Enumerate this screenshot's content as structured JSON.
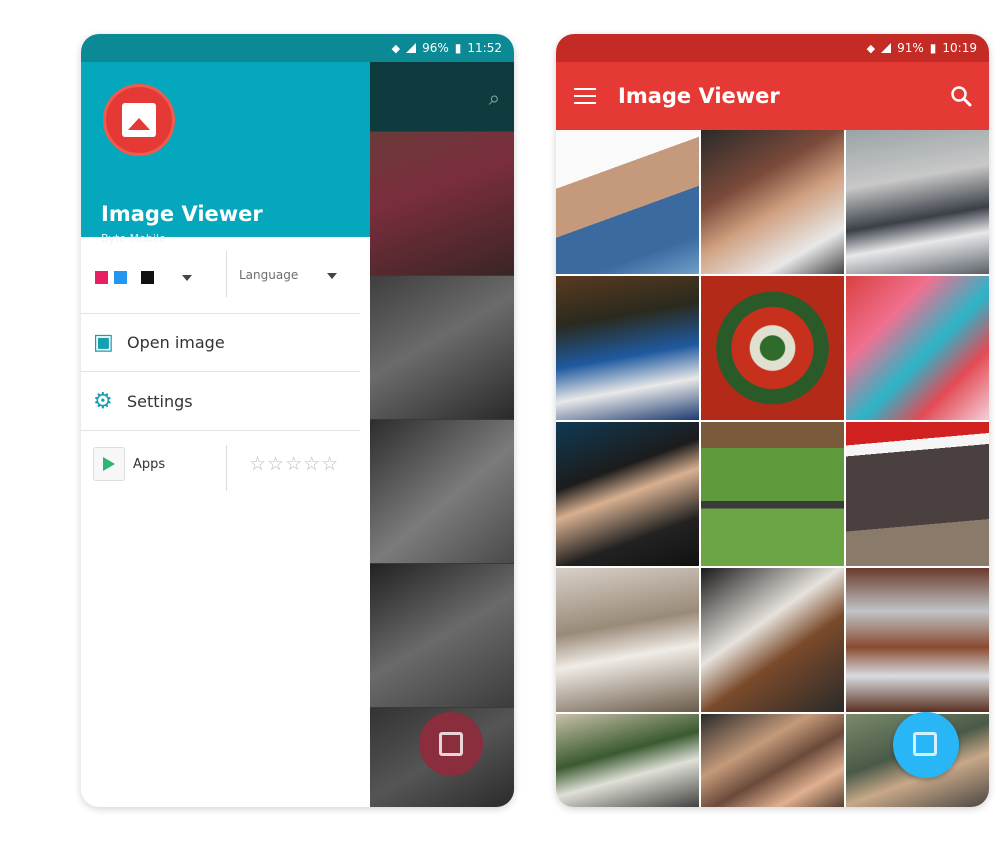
{
  "left_phone": {
    "status": {
      "battery": "96%",
      "time": "11:52"
    },
    "drawer": {
      "app_name": "Image Viewer",
      "developer": "Byte Mobile",
      "language_label": "Language",
      "open_image_label": "Open image",
      "settings_label": "Settings",
      "apps_label": "Apps",
      "rating_stars": "☆☆☆☆☆"
    },
    "theme_swatches": [
      "#e91e63",
      "#2196f3",
      "#111111"
    ]
  },
  "right_phone": {
    "status": {
      "battery": "91%",
      "time": "10:19"
    },
    "title": "Image Viewer"
  },
  "colors": {
    "teal": "#04a7bc",
    "red": "#e53935",
    "fab_blue": "#29b6f6"
  },
  "icons": [
    "search-icon",
    "menu-icon",
    "gallery-icon",
    "settings-icon",
    "play-store-icon",
    "star-icon"
  ],
  "photos": [
    {
      "label": "selfie-couple"
    },
    {
      "label": "couple-sunglasses"
    },
    {
      "label": "man-street"
    },
    {
      "label": "champagne-bucket"
    },
    {
      "label": "caprese-plate"
    },
    {
      "label": "candy-cards"
    },
    {
      "label": "man-portrait"
    },
    {
      "label": "dog-lawn"
    },
    {
      "label": "dog-santa-hat"
    },
    {
      "label": "horse-carriage"
    },
    {
      "label": "tote-bag"
    },
    {
      "label": "paper-lanterns"
    },
    {
      "label": "man-yard"
    },
    {
      "label": "friends-selfie"
    },
    {
      "label": "crowd"
    }
  ]
}
